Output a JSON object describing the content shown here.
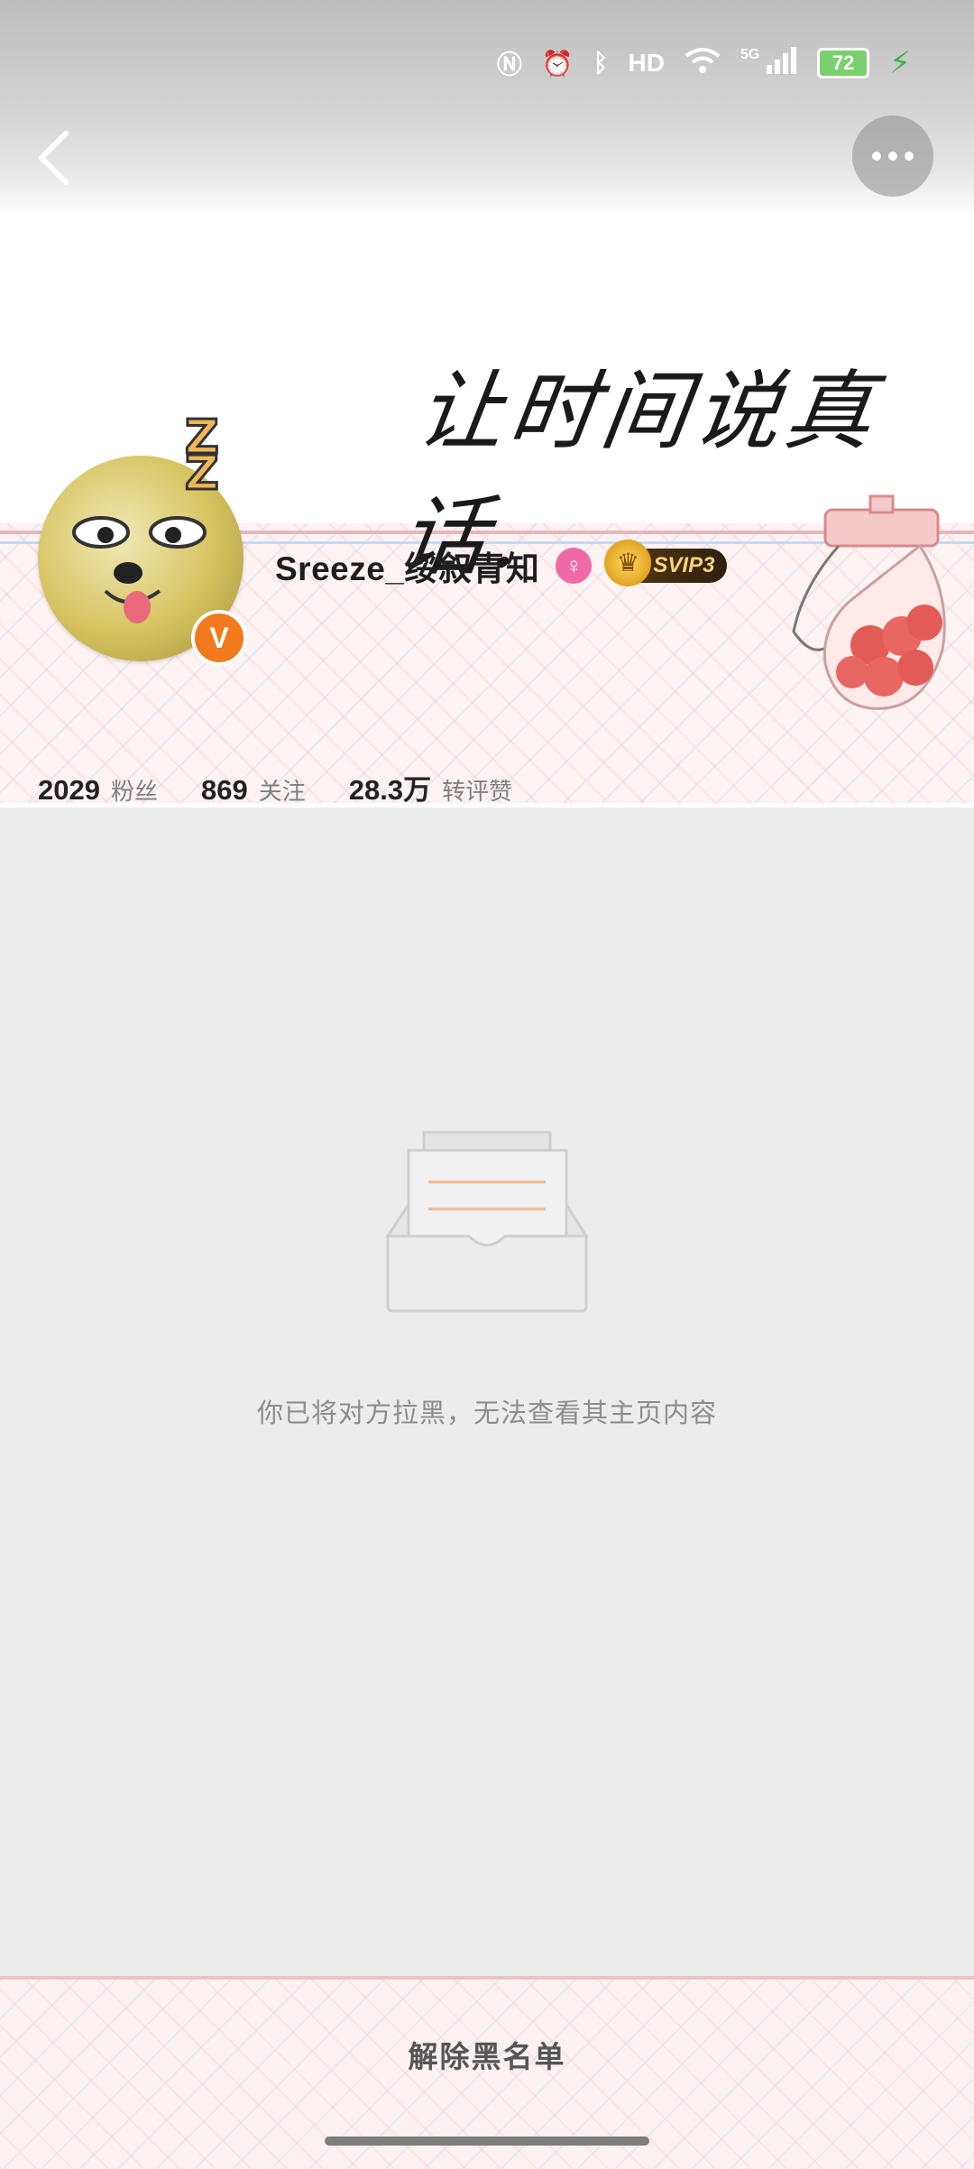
{
  "status_bar": {
    "battery_level": "72",
    "network_label": "5G",
    "hd_label": "HD"
  },
  "cover": {
    "calligraphy_text": "让时间说真话."
  },
  "profile": {
    "username": "Sreeze_绥叙青知",
    "vip_label": "SVIP3",
    "verified_badge": "V"
  },
  "stats": [
    {
      "value": "2029",
      "label": "粉丝"
    },
    {
      "value": "869",
      "label": "关注"
    },
    {
      "value": "28.3万",
      "label": "转评赞"
    }
  ],
  "empty_state": {
    "message": "你已将对方拉黑，无法查看其主页内容"
  },
  "bottom_bar": {
    "unblock_label": "解除黑名单"
  },
  "colors": {
    "accent_orange": "#f07a1c",
    "gender_pink": "#f06aa7",
    "background_gray": "#ececec"
  }
}
